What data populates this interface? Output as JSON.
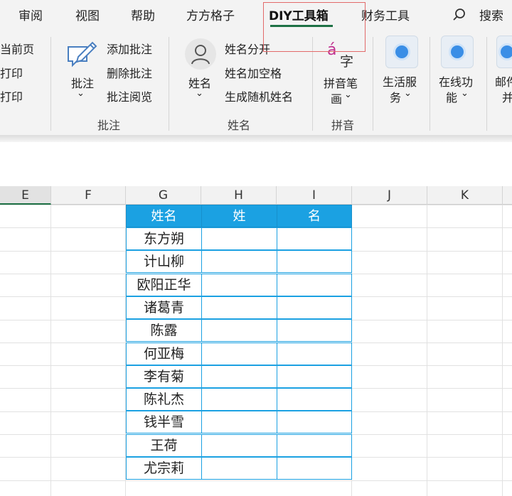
{
  "tabs": [
    "审阅",
    "视图",
    "帮助",
    "方方格子",
    "DIY工具箱",
    "财务工具"
  ],
  "search_label": "搜索",
  "ribbon": {
    "left_partial": [
      "当前页",
      "打印",
      "打印"
    ],
    "annotation_group": {
      "big_button": "批注",
      "items": [
        "添加批注",
        "删除批注",
        "批注阅览"
      ],
      "label": "批注"
    },
    "name_group": {
      "big_button": "姓名",
      "items": [
        "姓名分开",
        "姓名加空格",
        "生成随机姓名"
      ],
      "label": "姓名"
    },
    "pinyin_group": {
      "icon_top": "á",
      "icon_char": "字",
      "line1": "拼音笔",
      "line2": "画",
      "label": "拼音"
    },
    "life_service": {
      "line1": "生活服",
      "line2": "务"
    },
    "online_func": {
      "line1": "在线功",
      "line2": "能"
    },
    "mail_partial": {
      "line1": "邮件",
      "line2": "并"
    }
  },
  "columns": [
    "E",
    "F",
    "G",
    "H",
    "I",
    "J",
    "K"
  ],
  "table": {
    "headers": [
      "姓名",
      "姓",
      "名"
    ],
    "names": [
      "东方朔",
      "计山柳",
      "欧阳正华",
      "诸葛青",
      "陈露",
      "何亚梅",
      "李有菊",
      "陈礼杰",
      "钱半雪",
      "王荷",
      "尤宗莉"
    ]
  },
  "colors": {
    "header_blue": "#1ba1e2",
    "active_tab_underline": "#1e7145",
    "highlight_box": "#e26a6a"
  }
}
